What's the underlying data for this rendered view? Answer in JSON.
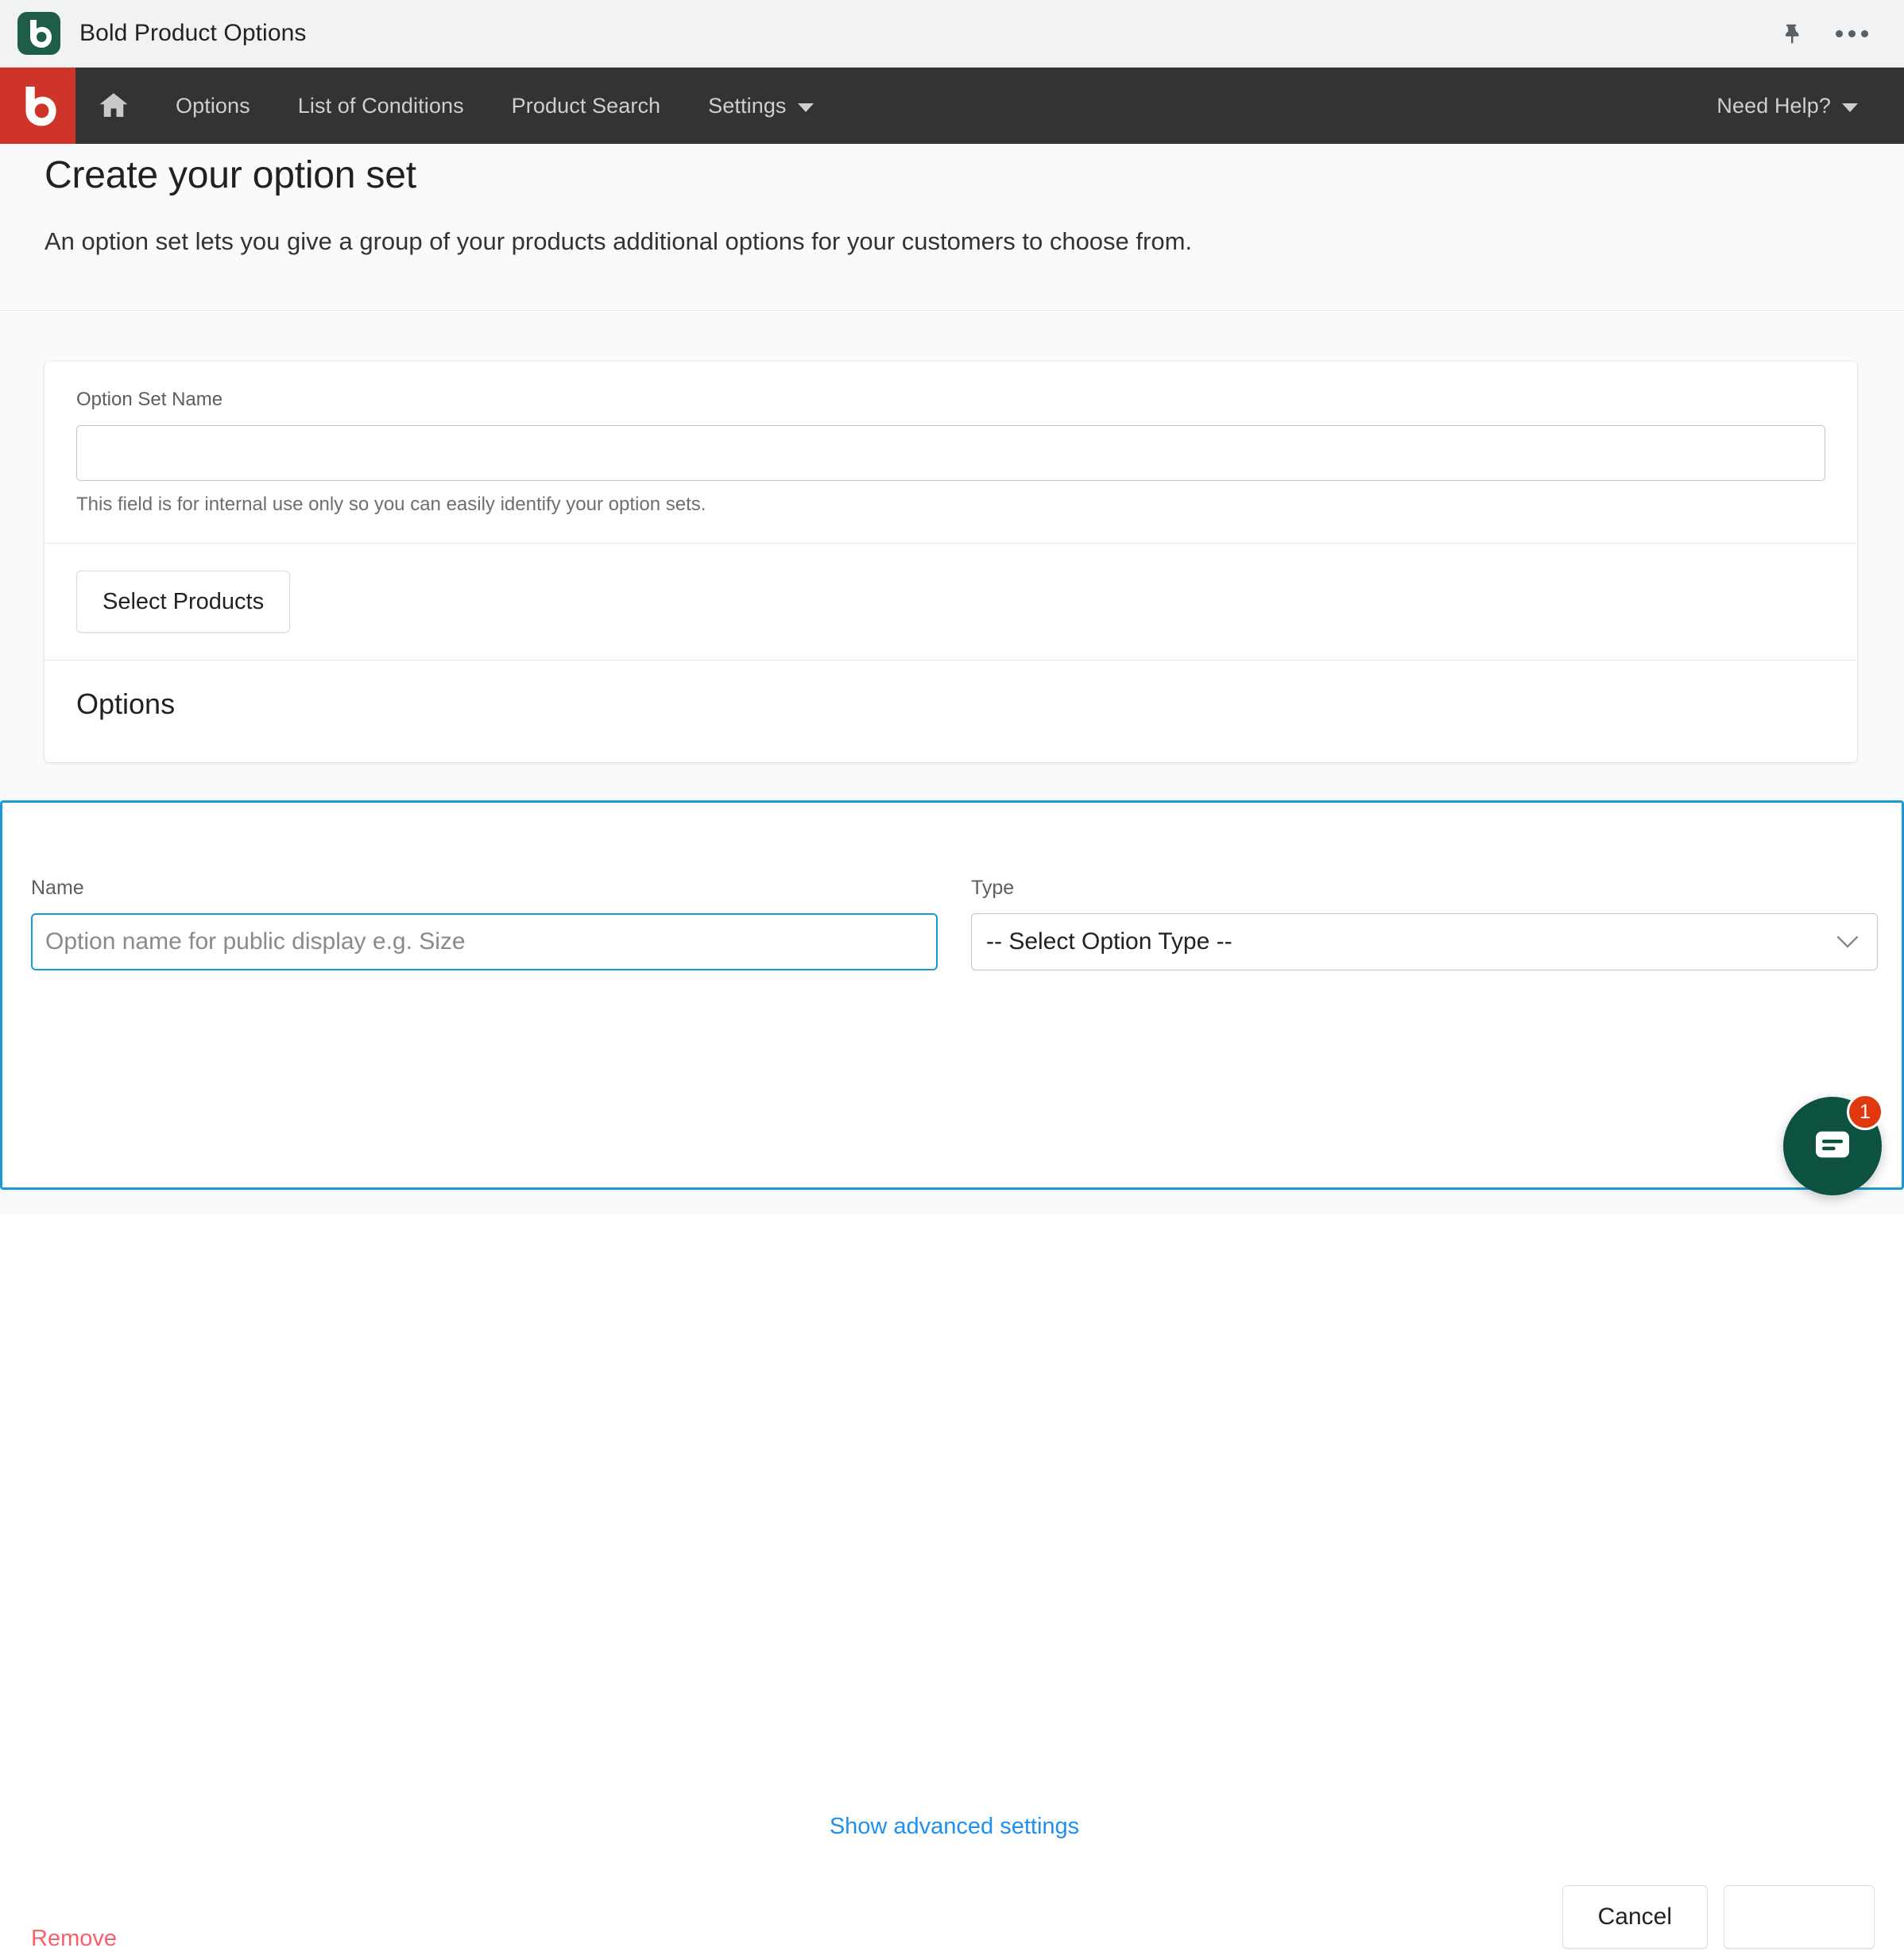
{
  "app_chrome": {
    "title": "Bold Product Options",
    "logo_icon": "bold-b-logo-icon",
    "pin_icon": "pushpin-icon",
    "more_icon": "more-horizontal-icon"
  },
  "nav": {
    "brand_icon": "bold-b-brand-icon",
    "home_icon": "home-icon",
    "items": [
      {
        "label": "Options",
        "caret": false
      },
      {
        "label": "List of Conditions",
        "caret": false
      },
      {
        "label": "Product Search",
        "caret": false
      },
      {
        "label": "Settings",
        "caret": true
      }
    ],
    "help": {
      "label": "Need Help?",
      "caret": true
    },
    "brand_color": "#ce3427",
    "bar_color": "#333333"
  },
  "page": {
    "title": "Create your option set",
    "subtitle": "An option set lets you give a group of your products additional options for your customers to choose from."
  },
  "option_set_card": {
    "name_field": {
      "label": "Option Set Name",
      "value": "",
      "placeholder": "",
      "help": "This field is for internal use only so you can easily identify your option sets."
    },
    "select_products_button": "Select Products",
    "options_heading": "Options"
  },
  "option_panel": {
    "name": {
      "label": "Name",
      "value": "",
      "placeholder": "Option name for public display e.g. Size"
    },
    "type": {
      "label": "Type",
      "selected": "-- Select Option Type --",
      "caret_icon": "chevron-down-icon"
    },
    "advanced_link": "Show advanced settings",
    "remove_link": "Remove",
    "cancel_button": "Cancel",
    "secondary_button": "",
    "border_color": "#1a9bd7",
    "link_color": "#1e90f0",
    "remove_color": "#fa5f6d"
  },
  "chat_widget": {
    "icon": "chat-message-icon",
    "badge_count": "1",
    "bubble_color": "#0d5141",
    "badge_color": "#e0380f"
  }
}
